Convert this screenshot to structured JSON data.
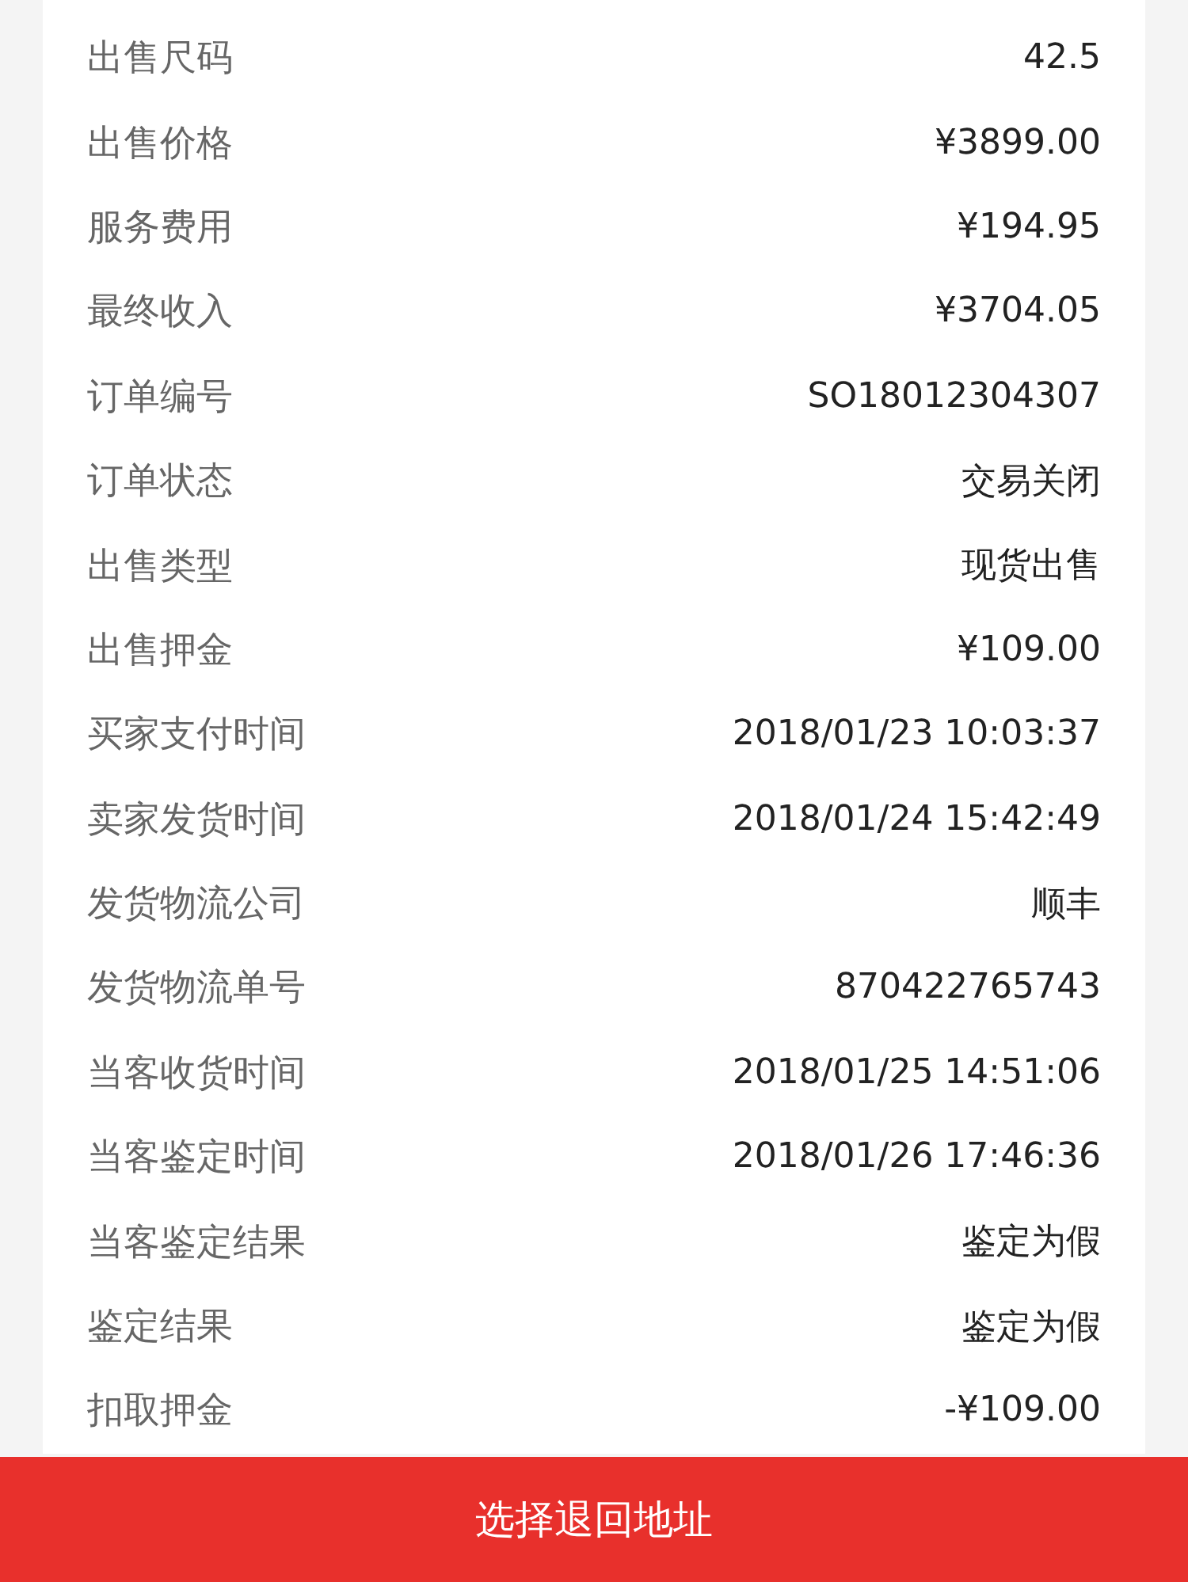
{
  "details": [
    {
      "label": "出售尺码",
      "value": "42.5"
    },
    {
      "label": "出售价格",
      "value": "¥3899.00"
    },
    {
      "label": "服务费用",
      "value": "¥194.95"
    },
    {
      "label": "最终收入",
      "value": "¥3704.05"
    },
    {
      "label": "订单编号",
      "value": "SO18012304307"
    },
    {
      "label": "订单状态",
      "value": "交易关闭"
    },
    {
      "label": "出售类型",
      "value": "现货出售"
    },
    {
      "label": "出售押金",
      "value": "¥109.00"
    },
    {
      "label": "买家支付时间",
      "value": "2018/01/23 10:03:37"
    },
    {
      "label": "卖家发货时间",
      "value": "2018/01/24 15:42:49"
    },
    {
      "label": "发货物流公司",
      "value": "顺丰"
    },
    {
      "label": "发货物流单号",
      "value": "870422765743"
    },
    {
      "label": "当客收货时间",
      "value": "2018/01/25 14:51:06"
    },
    {
      "label": "当客鉴定时间",
      "value": "2018/01/26 17:46:36"
    },
    {
      "label": "当客鉴定结果",
      "value": "鉴定为假"
    },
    {
      "label": "鉴定结果",
      "value": "鉴定为假"
    },
    {
      "label": "扣取押金",
      "value": "-¥109.00"
    }
  ],
  "action_button": "选择退回地址"
}
